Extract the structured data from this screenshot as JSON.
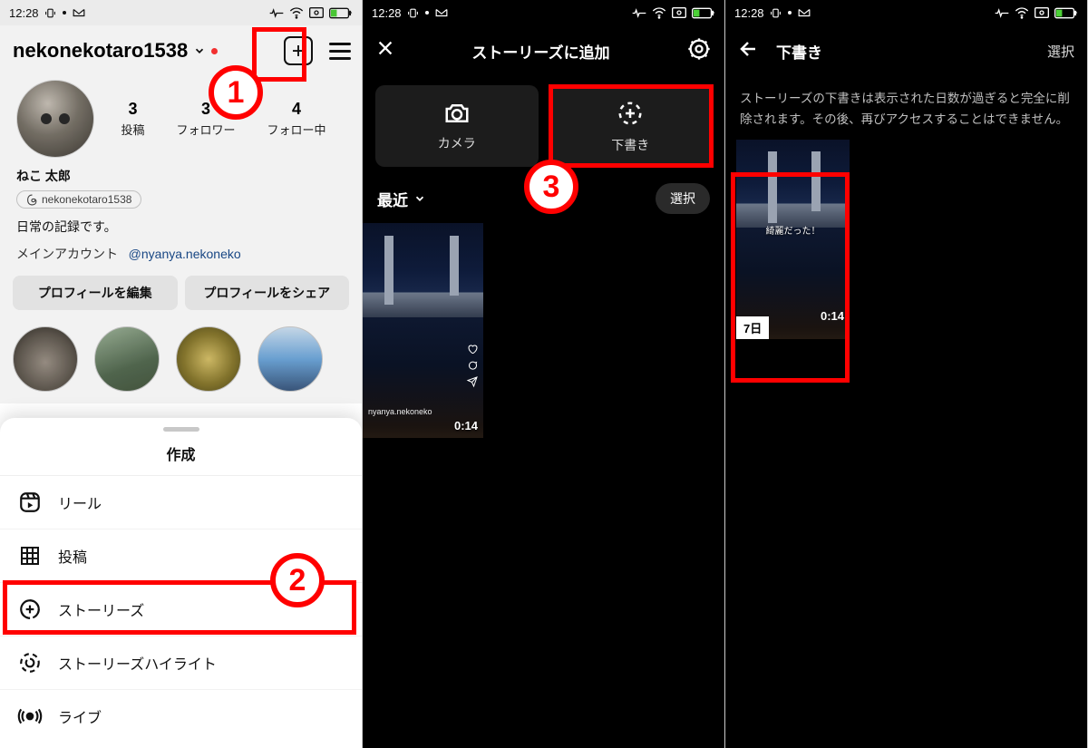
{
  "status": {
    "time": "12:28"
  },
  "screen1": {
    "username": "nekonekotaro1538",
    "stats": {
      "posts_num": "3",
      "posts_lbl": "投稿",
      "followers_num": "3",
      "followers_lbl": "フォロワー",
      "following_num": "4",
      "following_lbl": "フォロー中"
    },
    "display_name": "ねこ 太郎",
    "threads_handle": "nekonekotaro1538",
    "bio": "日常の記録です。",
    "mainaccount_label": "メインアカウント",
    "mainaccount_link": "@nyanya.nekoneko",
    "edit_btn": "プロフィールを編集",
    "share_btn": "プロフィールをシェア",
    "sheet_title": "作成",
    "sheet_items": [
      "リール",
      "投稿",
      "ストーリーズ",
      "ストーリーズハイライト",
      "ライブ"
    ]
  },
  "screen2": {
    "title": "ストーリーズに追加",
    "tab_camera": "カメラ",
    "tab_drafts": "下書き",
    "recent": "最近",
    "select": "選択",
    "thumb_duration": "0:14"
  },
  "screen3": {
    "title": "下書き",
    "select": "選択",
    "desc": "ストーリーズの下書きは表示された日数が過ぎると完全に削除されます。その後、再びアクセスすることはできません。",
    "thumb_days": "7日",
    "thumb_duration": "0:14",
    "thumb_caption": "綺麗だった！"
  },
  "callouts": {
    "c1": "1",
    "c2": "2",
    "c3": "3"
  },
  "colors": {
    "red": "#ff0000"
  }
}
